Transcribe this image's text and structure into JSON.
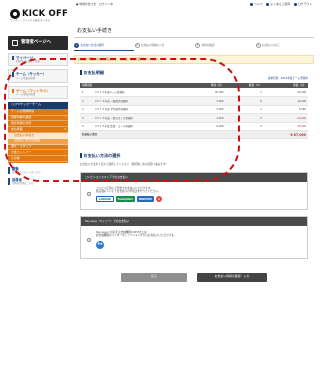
{
  "header": {
    "logo_text": "KICK OFF",
    "logo_sub": "サッカー・フットサル総合ポータル",
    "welcome": "● 地域の皆さま　ログイン中",
    "links": [
      "ヘルプ",
      "よくあるご質問",
      "ログアウト"
    ]
  },
  "sidebar": {
    "mypage": "管理者ページへ",
    "mypage_box_title": "マイページ",
    "mypage_box_sub": "登録内容の確認・変更",
    "team_title": "チーム（サッカー）",
    "team_sub": "チーム情報の管理",
    "team_futsal_title": "チーム（フットサル）",
    "team_futsal_sub": "チーム情報の管理",
    "team_select": "○○FCサッカーチーム",
    "menu": [
      "チームの登録申請",
      "登録内容の確認",
      "選手登録の状況",
      "支払管理",
      "選手・スタッフ",
      "大会エントリー",
      "その他"
    ],
    "submenu": [
      "お支払い手続き",
      "お支払い状況の確認"
    ],
    "news_title": "書類",
    "news_sub": "各種ダウンロードはこちら",
    "support_title": "指導者",
    "support_sub": "指導者登録はこちら"
  },
  "main": {
    "title": "お支払い手続き",
    "steps": [
      "お支払い方法の選択",
      "お支払い情報の入力",
      "内容の確認",
      "お支払いの完了"
    ],
    "notice": "お支払い明細の内容をご確認の上、お支払い方法を選択してください。",
    "details": {
      "title": "お支払明細",
      "note": "請求名称：2014年度チーム登録料",
      "columns": [
        "明細項目",
        "単価（円）",
        "数量（人）",
        "金額（円）"
      ],
      "rows": [
        [
          "1",
          "２０１４年度チーム登録料",
          "20,000",
          "1",
          "20,000"
        ],
        [
          "2",
          "２０１４年度 一般選手登録料",
          "2,000",
          "6",
          "12,000"
        ],
        [
          "3",
          "２０１４年度 学生選手登録料",
          "5,000",
          "1",
          "5,000"
        ],
        [
          "4",
          "２０１４年度 一般スタッフ登録料",
          "4,000",
          "5",
          "20,000"
        ],
        [
          "5",
          "２０１４年度 監督・コーチ登録料",
          "6,000",
          "5",
          "30,000"
        ]
      ],
      "total_label": "お支払い合計",
      "total": "¥ 87,000"
    },
    "method": {
      "title": "お支払い方法の選択",
      "desc": "お支払い方法を下記から選択してください（選択後に次の画面へ進みます）",
      "conv_head": "コンビニエンスストアでのお支払い",
      "conv_line1": "コンビニ店頭にて現金でお支払いいただけます。",
      "conv_line2": "各店舗のレジにてお支払いの手続きを行ってください。",
      "conv_logos": [
        "LAWSON",
        "FamilyMart",
        "MINISTOP",
        "SEICO"
      ],
      "payeasy_head": "Pay-easy（ペイジー）でのお支払い",
      "payeasy_line1": "Pay-easyに対応する金融機関のATMまたは",
      "payeasy_line2": "各金融機関のインターネットバンキングからお支払いいただけます。",
      "payeasy_logo": "Pe"
    },
    "buttons": {
      "back": "戻る",
      "next": "お支払い情報の確認・入力"
    }
  }
}
